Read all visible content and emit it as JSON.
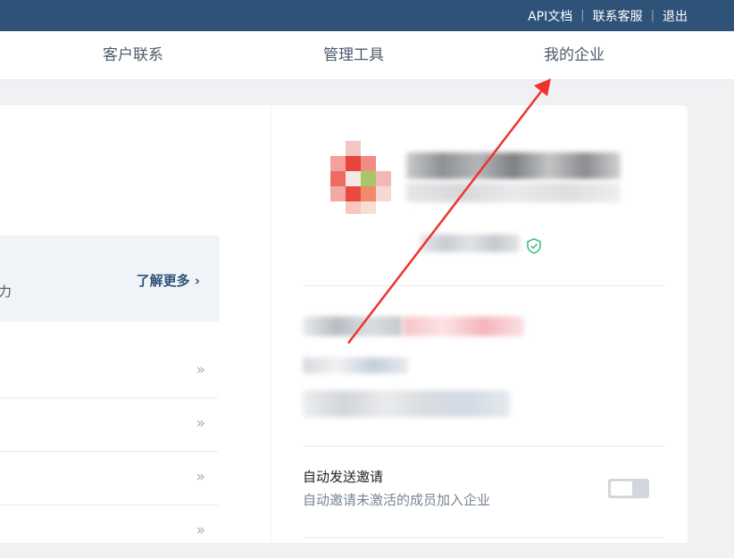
{
  "header": {
    "links": [
      {
        "label": "API文档"
      },
      {
        "label": "联系客服"
      },
      {
        "label": "退出"
      }
    ],
    "separator": "|"
  },
  "nav": {
    "items": [
      {
        "label": "客户联系"
      },
      {
        "label": "管理工具"
      },
      {
        "label": "我的企业"
      }
    ]
  },
  "left_panel": {
    "promo_fragment": "力",
    "learn_more_label": "了解更多",
    "learn_more_chevron": "›",
    "rows": [
      {
        "chevron": "»"
      },
      {
        "chevron": "»"
      },
      {
        "chevron": "»"
      },
      {
        "chevron": "»"
      }
    ]
  },
  "right_panel": {
    "company_logo": "pixelated-logo",
    "verified_icon": "shield-check-icon",
    "auto_invite": {
      "title": "自动发送邀请",
      "description": "自动邀请未激活的成员加入企业",
      "toggle_on": false
    }
  },
  "annotation": {
    "arrow_color": "#f0322d"
  },
  "colors": {
    "header_bg": "#2f5279",
    "accent": "#2f5279",
    "verified": "#3ec08a"
  }
}
